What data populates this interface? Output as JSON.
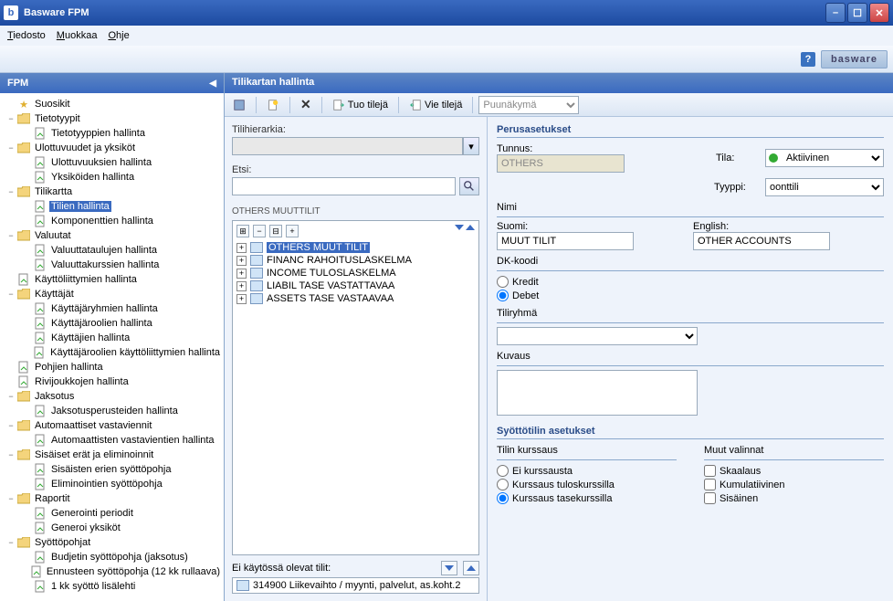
{
  "window": {
    "title": "Basware FPM",
    "app_icon_letter": "b"
  },
  "menu": {
    "file": "Tiedosto",
    "edit": "Muokkaa",
    "help": "Ohje"
  },
  "brand": {
    "help": "?",
    "logo": "basware"
  },
  "sidebar": {
    "title": "FPM",
    "items": [
      {
        "type": "leaf",
        "icon": "star",
        "label": "Suosikit",
        "indent": 0,
        "toggle": ""
      },
      {
        "type": "folder",
        "icon": "folder",
        "label": "Tietotyypit",
        "indent": 0,
        "toggle": "−"
      },
      {
        "type": "leaf",
        "icon": "doc",
        "label": "Tietotyyppien hallinta",
        "indent": 1,
        "toggle": ""
      },
      {
        "type": "folder",
        "icon": "folder",
        "label": "Ulottuvuudet ja yksiköt",
        "indent": 0,
        "toggle": "−"
      },
      {
        "type": "leaf",
        "icon": "doc",
        "label": "Ulottuvuuksien hallinta",
        "indent": 1,
        "toggle": ""
      },
      {
        "type": "leaf",
        "icon": "doc",
        "label": "Yksiköiden hallinta",
        "indent": 1,
        "toggle": ""
      },
      {
        "type": "folder",
        "icon": "folder",
        "label": "Tilikartta",
        "indent": 0,
        "toggle": "−"
      },
      {
        "type": "leaf",
        "icon": "doc",
        "label": "Tilien hallinta",
        "indent": 1,
        "toggle": "",
        "selected": true
      },
      {
        "type": "leaf",
        "icon": "doc",
        "label": "Komponenttien hallinta",
        "indent": 1,
        "toggle": ""
      },
      {
        "type": "folder",
        "icon": "folder",
        "label": "Valuutat",
        "indent": 0,
        "toggle": "−"
      },
      {
        "type": "leaf",
        "icon": "doc",
        "label": "Valuuttataulujen hallinta",
        "indent": 1,
        "toggle": ""
      },
      {
        "type": "leaf",
        "icon": "doc",
        "label": "Valuuttakurssien hallinta",
        "indent": 1,
        "toggle": ""
      },
      {
        "type": "leaf",
        "icon": "doc",
        "label": "Käyttöliittymien hallinta",
        "indent": 0,
        "toggle": ""
      },
      {
        "type": "folder",
        "icon": "folder",
        "label": "Käyttäjät",
        "indent": 0,
        "toggle": "−"
      },
      {
        "type": "leaf",
        "icon": "doc",
        "label": "Käyttäjäryhmien hallinta",
        "indent": 1,
        "toggle": ""
      },
      {
        "type": "leaf",
        "icon": "doc",
        "label": "Käyttäjäroolien hallinta",
        "indent": 1,
        "toggle": ""
      },
      {
        "type": "leaf",
        "icon": "doc",
        "label": "Käyttäjien hallinta",
        "indent": 1,
        "toggle": ""
      },
      {
        "type": "leaf",
        "icon": "doc",
        "label": "Käyttäjäroolien käyttöliittymien hallinta",
        "indent": 1,
        "toggle": ""
      },
      {
        "type": "leaf",
        "icon": "doc",
        "label": "Pohjien hallinta",
        "indent": 0,
        "toggle": ""
      },
      {
        "type": "leaf",
        "icon": "doc",
        "label": "Rivijoukkojen hallinta",
        "indent": 0,
        "toggle": ""
      },
      {
        "type": "folder",
        "icon": "folder",
        "label": "Jaksotus",
        "indent": 0,
        "toggle": "−"
      },
      {
        "type": "leaf",
        "icon": "doc",
        "label": "Jaksotusperusteiden hallinta",
        "indent": 1,
        "toggle": ""
      },
      {
        "type": "folder",
        "icon": "folder",
        "label": "Automaattiset vastaviennit",
        "indent": 0,
        "toggle": "−"
      },
      {
        "type": "leaf",
        "icon": "doc",
        "label": "Automaattisten vastavientien hallinta",
        "indent": 1,
        "toggle": ""
      },
      {
        "type": "folder",
        "icon": "folder",
        "label": "Sisäiset erät ja eliminoinnit",
        "indent": 0,
        "toggle": "−"
      },
      {
        "type": "leaf",
        "icon": "doc",
        "label": "Sisäisten erien syöttöpohja",
        "indent": 1,
        "toggle": ""
      },
      {
        "type": "leaf",
        "icon": "doc",
        "label": "Eliminointien syöttöpohja",
        "indent": 1,
        "toggle": ""
      },
      {
        "type": "folder",
        "icon": "folder",
        "label": "Raportit",
        "indent": 0,
        "toggle": "−"
      },
      {
        "type": "leaf",
        "icon": "doc",
        "label": "Generointi periodit",
        "indent": 1,
        "toggle": ""
      },
      {
        "type": "leaf",
        "icon": "doc",
        "label": "Generoi yksiköt",
        "indent": 1,
        "toggle": ""
      },
      {
        "type": "folder",
        "icon": "folder",
        "label": "Syöttöpohjat",
        "indent": 0,
        "toggle": "−"
      },
      {
        "type": "leaf",
        "icon": "doc",
        "label": "Budjetin syöttöpohja (jaksotus)",
        "indent": 1,
        "toggle": ""
      },
      {
        "type": "leaf",
        "icon": "doc",
        "label": "Ennusteen syöttöpohja (12 kk rullaava)",
        "indent": 1,
        "toggle": ""
      },
      {
        "type": "leaf",
        "icon": "doc",
        "label": "1 kk syöttö lisälehti",
        "indent": 1,
        "toggle": ""
      }
    ]
  },
  "content": {
    "header": "Tilikartan hallinta",
    "toolbar": {
      "save": "",
      "new": "",
      "delete": "",
      "import": "Tuo tilejä",
      "export": "Vie tilejä",
      "view_select": "Puunäkymä"
    },
    "left": {
      "hierarchy_label": "Tilihierarkia:",
      "search_label": "Etsi:",
      "breadcrumb": "OTHERS MUUTTILIT",
      "nodes": [
        {
          "label": "OTHERS MUUT TILIT",
          "selected": true
        },
        {
          "label": "FINANC RAHOITUSLASKELMA"
        },
        {
          "label": "INCOME TULOSLASKELMA"
        },
        {
          "label": "LIABIL TASE VASTATTAVAA"
        },
        {
          "label": "ASSETS TASE VASTAAVAA"
        }
      ],
      "unused_label": "Ei käytössä olevat tilit:",
      "unused_item": "314900 Liikevaihto / myynti, palvelut, as.koht.2"
    },
    "right": {
      "basic_title": "Perusasetukset",
      "id_label": "Tunnus:",
      "id_value": "OTHERS",
      "status_label": "Tila:",
      "status_value": "Aktiivinen",
      "type_label": "Tyyppi:",
      "type_value": "oonttili",
      "name_label": "Nimi",
      "fi_label": "Suomi:",
      "fi_value": "MUUT TILIT",
      "en_label": "English:",
      "en_value": "OTHER ACCOUNTS",
      "dk_label": "DK-koodi",
      "kredit": "Kredit",
      "debet": "Debet",
      "group_label": "Tiliryhmä",
      "desc_label": "Kuvaus",
      "input_title": "Syöttötilin asetukset",
      "rate_title": "Tilin kurssaus",
      "rate_none": "Ei kurssausta",
      "rate_result": "Kurssaus tuloskurssilla",
      "rate_balance": "Kurssaus tasekurssilla",
      "other_title": "Muut valinnat",
      "scaling": "Skaalaus",
      "cumulative": "Kumulatiivinen",
      "internal": "Sisäinen"
    }
  }
}
